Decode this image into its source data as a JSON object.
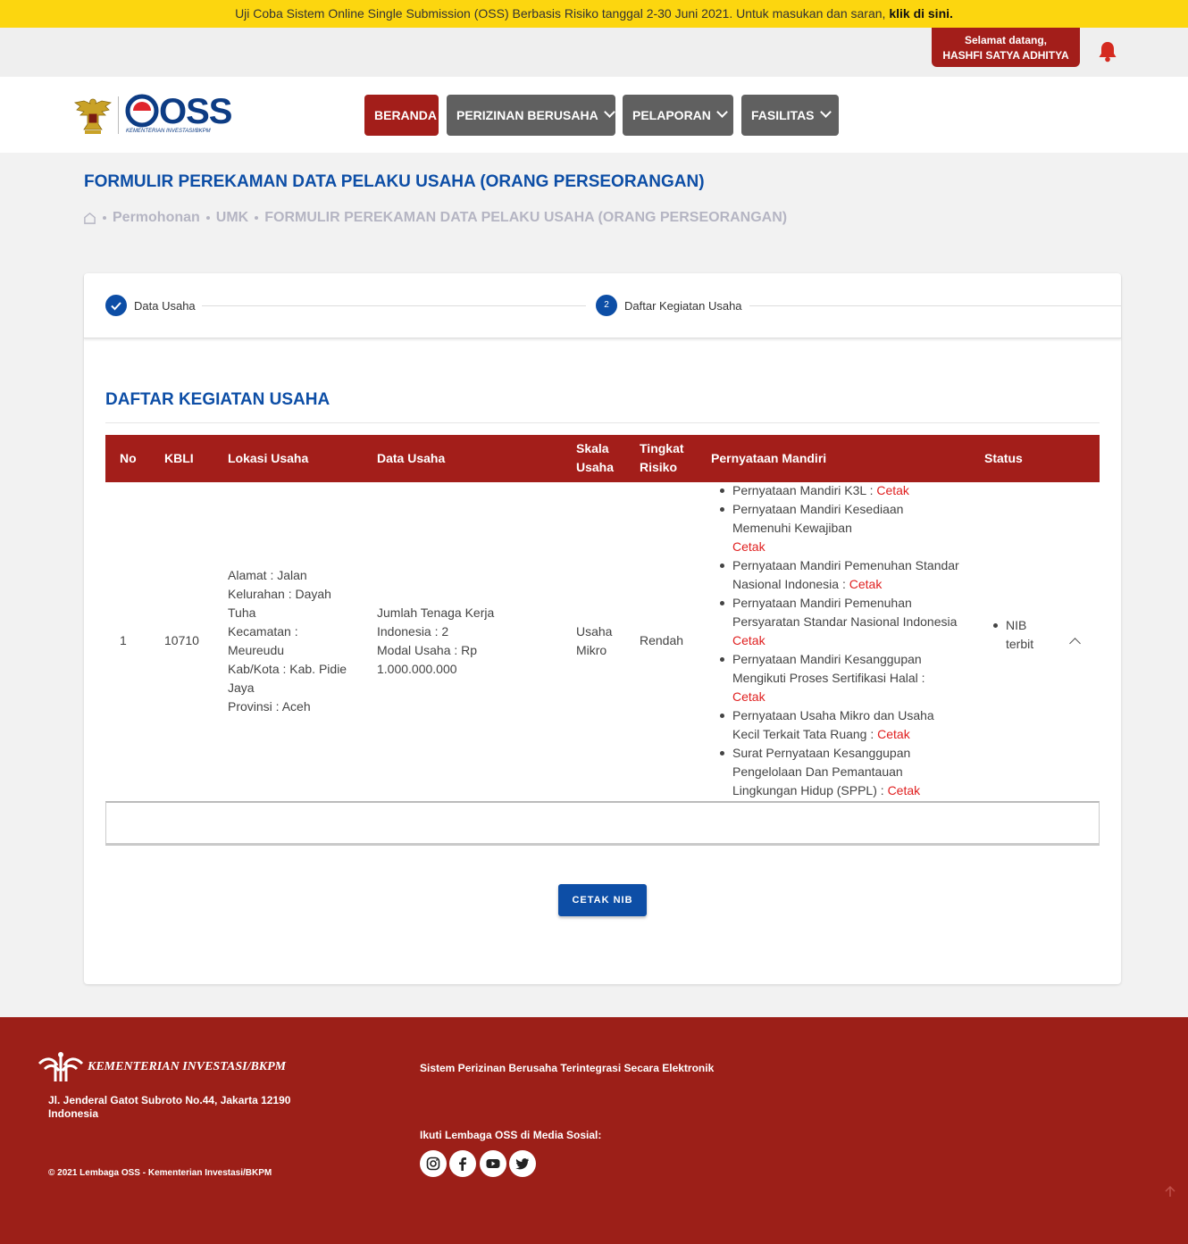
{
  "banner": {
    "text": "Uji Coba Sistem Online Single Submission (OSS) Berbasis Risiko tanggal 2-30 Juni 2021. Untuk masukan dan saran, ",
    "link": "klik di sini."
  },
  "user": {
    "greeting": "Selamat datang,",
    "name": "HASHFI SATYA ADHITYA"
  },
  "brand": {
    "logo_text": "OSS",
    "logo_sub": "KEMENTERIAN INVESTASI/BKPM"
  },
  "nav": {
    "home": "BERANDA",
    "perizinan": "PERIZINAN BERUSAHA",
    "pelaporan": "PELAPORAN",
    "fasilitas": "FASILITAS"
  },
  "page": {
    "title": "FORMULIR PEREKAMAN DATA PELAKU USAHA (ORANG PERSEORANGAN)"
  },
  "breadcrumb": {
    "item1": "Permohonan",
    "item2": "UMK",
    "item3": "FORMULIR PEREKAMAN DATA PELAKU USAHA (ORANG PERSEORANGAN)"
  },
  "stepper": {
    "step1_label": "Data Usaha",
    "step2_number": "2",
    "step2_label": "Daftar Kegiatan Usaha"
  },
  "section": {
    "title": "DAFTAR KEGIATAN USAHA"
  },
  "table": {
    "headers": {
      "no": "No",
      "kbli": "KBLI",
      "lokasi": "Lokasi Usaha",
      "data": "Data Usaha",
      "skala_1": "Skala",
      "skala_2": "Usaha",
      "risiko_1": "Tingkat",
      "risiko_2": "Risiko",
      "pernyataan": "Pernyataan Mandiri",
      "status": "Status"
    },
    "row": {
      "no": "1",
      "kbli": "10710",
      "lokasi": [
        "Alamat : Jalan",
        "Kelurahan : Dayah",
        "Tuha",
        "Kecamatan :",
        "Meureudu",
        "Kab/Kota : Kab. Pidie",
        "Jaya",
        "Provinsi : Aceh"
      ],
      "data": [
        "Jumlah Tenaga Kerja",
        "Indonesia : 2",
        "Modal Usaha : Rp",
        "1.000.000.000"
      ],
      "skala": [
        "Usaha",
        "Mikro"
      ],
      "risiko": "Rendah",
      "status": [
        "NIB",
        "terbit"
      ],
      "cetak_label": "Cetak",
      "pernyataan": [
        {
          "lines": [
            "Pernyataan Mandiri K3L : "
          ]
        },
        {
          "lines": [
            "Pernyataan Mandiri Kesediaan",
            "Memenuhi Kewajiban"
          ]
        },
        {
          "lines": [
            "Pernyataan Mandiri Pemenuhan Standar",
            "Nasional Indonesia : "
          ]
        },
        {
          "lines": [
            "Pernyataan Mandiri Pemenuhan",
            "Persyaratan Standar Nasional Indonesia"
          ]
        },
        {
          "lines": [
            "Pernyataan Mandiri Kesanggupan",
            "Mengikuti Proses Sertifikasi Halal :"
          ]
        },
        {
          "lines": [
            "Pernyataan Usaha Mikro dan Usaha",
            "Kecil Terkait Tata Ruang : "
          ]
        },
        {
          "lines": [
            "Surat Pernyataan Kesanggupan",
            "Pengelolaan Dan Pemantauan",
            "Lingkungan Hidup (SPPL) : "
          ]
        }
      ]
    }
  },
  "actions": {
    "cetak_nib": "CETAK NIB"
  },
  "footer": {
    "brand": "KEMENTERIAN INVESTASI/BKPM",
    "address_1": "Jl. Jenderal Gatot Subroto No.44, Jakarta 12190",
    "address_2": "Indonesia",
    "copyright": "© 2021 Lembaga OSS - Kementerian Investasi/BKPM",
    "system": "Sistem Perizinan Berusaha Terintegrasi Secara Elektronik",
    "follow": "Ikuti Lembaga OSS di Media Sosial:",
    "social_icons": [
      "instagram-icon",
      "facebook-icon",
      "youtube-icon",
      "twitter-icon"
    ]
  },
  "colors": {
    "primary_blue": "#0d4ea6",
    "brand_red": "#a31e1a",
    "banner_yellow": "#fcd60f",
    "link_red": "#e02020"
  }
}
